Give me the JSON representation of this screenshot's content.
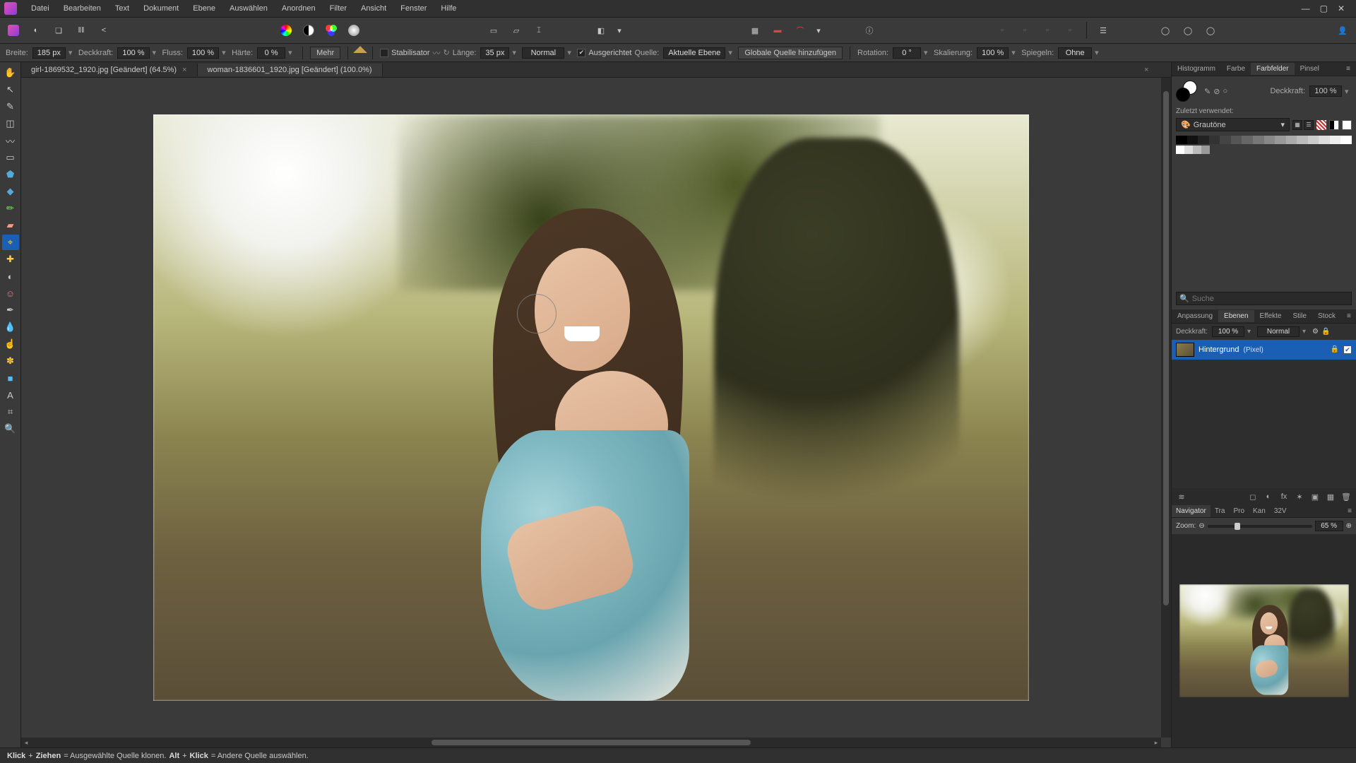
{
  "menu": {
    "items": [
      "Datei",
      "Bearbeiten",
      "Text",
      "Dokument",
      "Ebene",
      "Auswählen",
      "Anordnen",
      "Filter",
      "Ansicht",
      "Fenster",
      "Hilfe"
    ]
  },
  "context": {
    "width_label": "Breite:",
    "width_value": "185 px",
    "opacity_label": "Deckkraft:",
    "opacity_value": "100 %",
    "flow_label": "Fluss:",
    "flow_value": "100 %",
    "hardness_label": "Härte:",
    "hardness_value": "0 %",
    "more": "Mehr",
    "stabiliser": "Stabilisator",
    "length_label": "Länge:",
    "length_value": "35 px",
    "mode_value": "Normal",
    "aligned": "Ausgerichtet",
    "source_label": "Quelle:",
    "source_value": "Aktuelle Ebene",
    "global_source": "Globale Quelle hinzufügen",
    "rotation_label": "Rotation:",
    "rotation_value": "0 °",
    "scale_label": "Skalierung:",
    "scale_value": "100 %",
    "mirror_label": "Spiegeln:",
    "mirror_value": "Ohne"
  },
  "tabs": {
    "tab1": "girl-1869532_1920.jpg [Geändert] (64.5%)",
    "tab2": "woman-1836601_1920.jpg [Geändert] (100.0%)"
  },
  "right": {
    "top_tabs": {
      "histogram": "Histogramm",
      "color": "Farbe",
      "swatches": "Farbfelder",
      "brush": "Pinsel"
    },
    "opacity_label": "Deckkraft:",
    "opacity_value": "100 %",
    "recent": "Zuletzt verwendet:",
    "preset": "Grautöne",
    "search_placeholder": "Suche",
    "mid_tabs": {
      "adjust": "Anpassung",
      "layers": "Ebenen",
      "fx": "Effekte",
      "styles": "Stile",
      "stock": "Stock"
    },
    "layer_opacity_label": "Deckkraft:",
    "layer_opacity_value": "100 %",
    "layer_blend": "Normal",
    "layer_name": "Hintergrund",
    "layer_type": "(Pixel)",
    "nav_tabs": {
      "navigator": "Navigator",
      "tra": "Tra",
      "pro": "Pro",
      "kan": "Kan",
      "v32": "32V"
    },
    "zoom_label": "Zoom:",
    "zoom_value": "65 %"
  },
  "status": {
    "part1": "Klick",
    "part2": "+",
    "part3": "Ziehen",
    "part4": " = Ausgewählte Quelle klonen. ",
    "part5": "Alt",
    "part6": "+",
    "part7": "Klick",
    "part8": " = Andere Quelle auswählen."
  }
}
